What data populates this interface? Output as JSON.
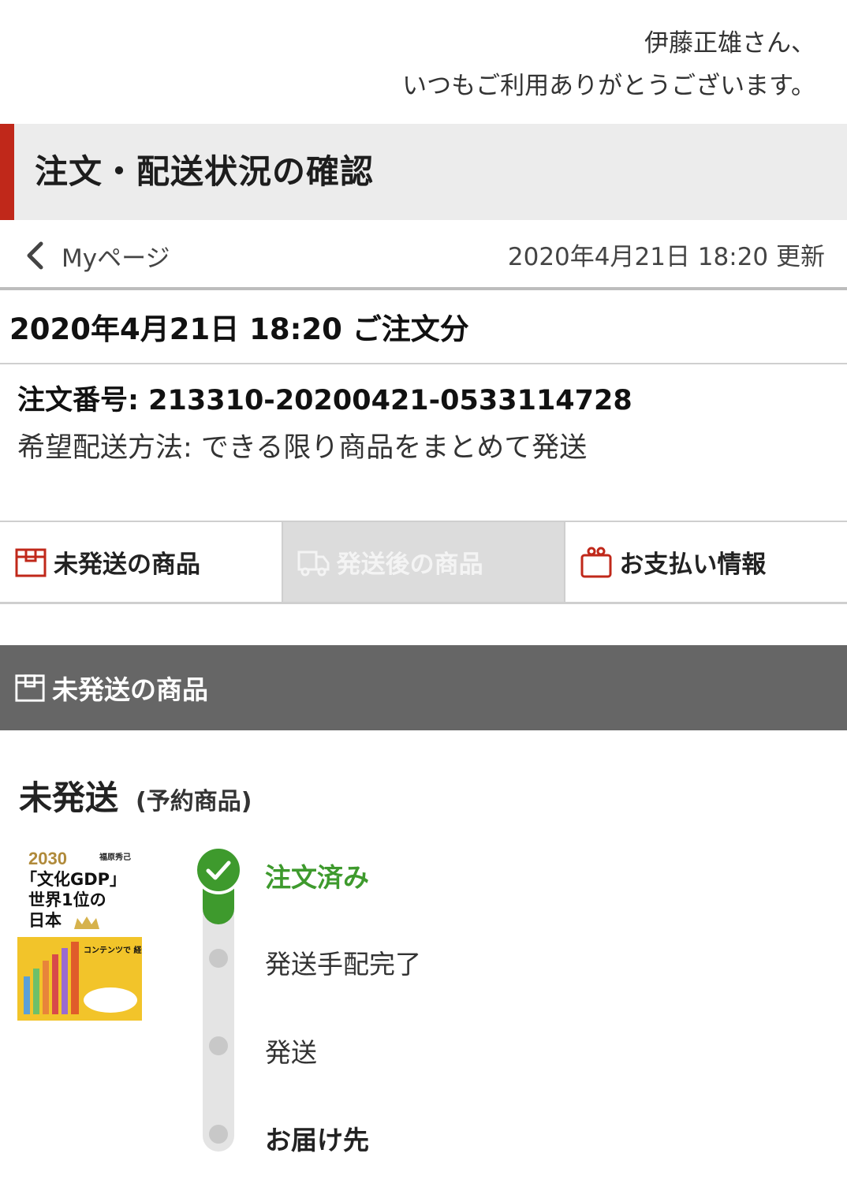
{
  "greeting": {
    "line1": "伊藤正雄さん、",
    "line2": "いつもご利用ありがとうございます。"
  },
  "page_title": "注文・配送状況の確認",
  "nav": {
    "back_label": "Myページ",
    "updated": "2020年4月21日 18:20 更新"
  },
  "order": {
    "heading": "2020年4月21日 18:20 ご注文分",
    "number": "注文番号: 213310-20200421-0533114728",
    "ship_method": "希望配送方法: できる限り商品をまとめて発送"
  },
  "tabs": [
    {
      "label": "未発送の商品",
      "icon": "package-icon",
      "active": false
    },
    {
      "label": "発送後の商品",
      "icon": "truck-icon",
      "active": true
    },
    {
      "label": "お支払い情報",
      "icon": "wallet-icon",
      "active": false
    }
  ],
  "section": {
    "label": "未発送の商品",
    "icon": "package-icon"
  },
  "status": {
    "main": "未発送",
    "sub": "(予約商品)"
  },
  "book": {
    "title_lines": [
      "2030",
      "「文化GDP」",
      "世界1位の",
      "日本"
    ],
    "author": "福原秀己",
    "band": "コンテンツで 経済大国に!!"
  },
  "timeline": {
    "steps": [
      {
        "label": "注文済み",
        "state": "done"
      },
      {
        "label": "発送手配完了",
        "state": "pending"
      },
      {
        "label": "発送",
        "state": "pending"
      },
      {
        "label": "お届け先",
        "state": "pending"
      }
    ]
  },
  "colors": {
    "accent_red": "#c0281a",
    "done_green": "#3e9a2d",
    "section_gray": "#666666"
  }
}
